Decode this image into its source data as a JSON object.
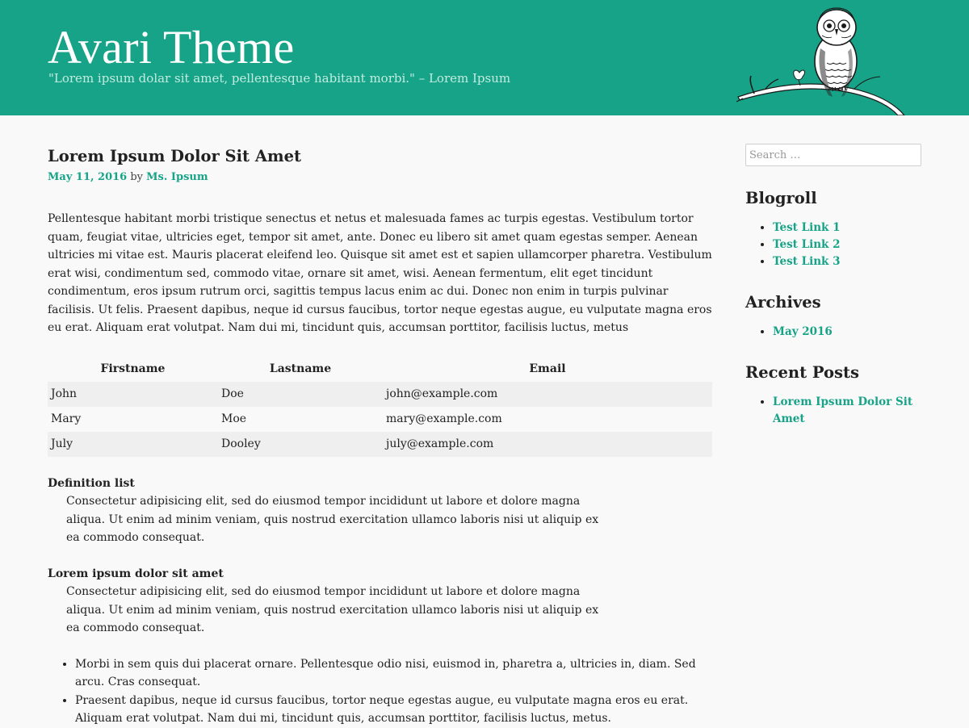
{
  "header": {
    "site_title": "Avari Theme",
    "site_description": "\"Lorem ipsum dolar sit amet, pellentesque habitant morbi.\" – Lorem Ipsum",
    "background_color": "#17a388",
    "illustration": "owl-on-branch"
  },
  "post": {
    "title": "Lorem Ipsum Dolor Sit Amet",
    "date": "May 11, 2016",
    "by_label": "by",
    "author": "Ms. Ipsum",
    "paragraph": "Pellentesque habitant morbi tristique senectus et netus et malesuada fames ac turpis egestas. Vestibulum tortor quam, feugiat vitae, ultricies eget, tempor sit amet, ante. Donec eu libero sit amet quam egestas semper. Aenean ultricies mi vitae est. Mauris placerat eleifend leo. Quisque sit amet est et sapien ullamcorper pharetra. Vestibulum erat wisi, condimentum sed, commodo vitae, ornare sit amet, wisi. Aenean fermentum, elit eget tincidunt condimentum, eros ipsum rutrum orci, sagittis tempus lacus enim ac dui. Donec non enim in turpis pulvinar facilisis. Ut felis. Praesent dapibus, neque id cursus faucibus, tortor neque egestas augue, eu vulputate magna eros eu erat. Aliquam erat volutpat. Nam dui mi, tincidunt quis, accumsan porttitor, facilisis luctus, metus",
    "table": {
      "headers": [
        "Firstname",
        "Lastname",
        "Email"
      ],
      "rows": [
        [
          "John",
          "Doe",
          "john@example.com"
        ],
        [
          "Mary",
          "Moe",
          "mary@example.com"
        ],
        [
          "July",
          "Dooley",
          "july@example.com"
        ]
      ]
    },
    "definitions": [
      {
        "term": "Definition list",
        "description": "Consectetur adipisicing elit, sed do eiusmod tempor incididunt ut labore et dolore magna aliqua. Ut enim ad minim veniam, quis nostrud exercitation ullamco laboris nisi ut aliquip ex ea commodo consequat."
      },
      {
        "term": "Lorem ipsum dolor sit amet",
        "description": "Consectetur adipisicing elit, sed do eiusmod tempor incididunt ut labore et dolore magna aliqua. Ut enim ad minim veniam, quis nostrud exercitation ullamco laboris nisi ut aliquip ex ea commodo consequat."
      }
    ],
    "list_items": [
      "Morbi in sem quis dui placerat ornare. Pellentesque odio nisi, euismod in, pharetra a, ultricies in, diam. Sed arcu. Cras consequat.",
      "Praesent dapibus, neque id cursus faucibus, tortor neque egestas augue, eu vulputate magna eros eu erat. Aliquam erat volutpat. Nam dui mi, tincidunt quis, accumsan porttitor, facilisis luctus, metus."
    ]
  },
  "sidebar": {
    "search_placeholder": "Search …",
    "blogroll": {
      "title": "Blogroll",
      "links": [
        "Test Link 1",
        "Test Link 2",
        "Test Link 3"
      ]
    },
    "archives": {
      "title": "Archives",
      "links": [
        "May 2016"
      ]
    },
    "recent_posts": {
      "title": "Recent Posts",
      "links": [
        "Lorem Ipsum Dolor Sit Amet"
      ]
    }
  },
  "colors": {
    "accent": "#17a388",
    "page_background": "#f9f9f9",
    "table_stripe": "#efefef"
  }
}
